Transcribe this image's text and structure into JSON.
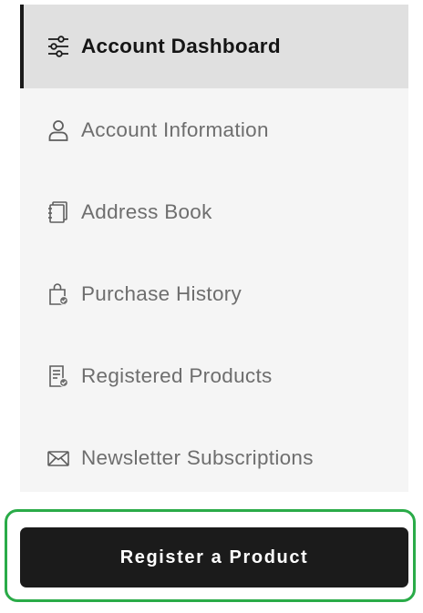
{
  "sidebar": {
    "items": [
      {
        "label": "Account Dashboard",
        "icon": "sliders-icon",
        "active": true
      },
      {
        "label": "Account Information",
        "icon": "user-icon",
        "active": false
      },
      {
        "label": "Address Book",
        "icon": "address-book-icon",
        "active": false
      },
      {
        "label": "Purchase History",
        "icon": "shopping-bag-check-icon",
        "active": false
      },
      {
        "label": "Registered Products",
        "icon": "receipt-check-icon",
        "active": false
      },
      {
        "label": "Newsletter Subscriptions",
        "icon": "envelope-icon",
        "active": false
      }
    ]
  },
  "register_button": {
    "label": "Register a Product"
  },
  "colors": {
    "nav_background": "#f5f5f5",
    "active_background": "#e0e0e0",
    "active_indicator": "#1a1a1a",
    "inactive_text": "#6e6e6e",
    "button_background": "#1b1b1b",
    "focus_ring": "#2aab48"
  }
}
